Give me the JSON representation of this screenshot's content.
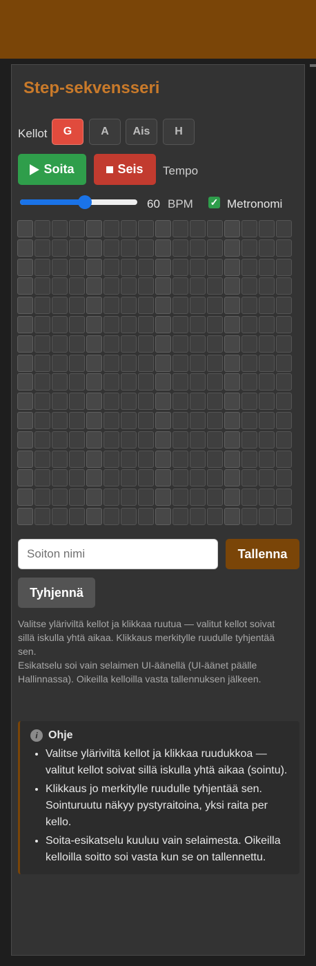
{
  "sequencer": {
    "title": "Step-sekvensseri",
    "bells_label": "Kellot",
    "bells": [
      {
        "label": "G",
        "selected": true
      },
      {
        "label": "A",
        "selected": false
      },
      {
        "label": "Ais",
        "selected": false
      },
      {
        "label": "H",
        "selected": false
      }
    ],
    "play_label": "Soita",
    "stop_label": "Seis",
    "tempo_label": "Tempo",
    "bpm_value": "60",
    "bpm_unit": "BPM",
    "tempo_level": 0.55,
    "metronome_label": "Metronomi",
    "metronome_checked": true,
    "grid": {
      "rows": 16,
      "columns": 16,
      "active_cells": 0
    },
    "name_placeholder": "Soiton nimi",
    "name_value": "",
    "save_label": "Tallenna",
    "clear_label": "Tyhjennä",
    "help_line1": "Valitse yläriviltä kellot ja klikkaa ruutua — valitut kellot soivat sillä iskulla yhtä aikaa. Klikkaus merkitylle ruudulle tyhjentää sen.",
    "help_line2": "Esikatselu soi vain selaimen UI-äänellä (UI-äänet päälle Hallinnassa). Oikeilla kelloilla vasta tallennuksen jälkeen.",
    "info": {
      "title": "Ohje",
      "items": [
        "Valitse yläriviltä kellot ja klikkaa ruudukkoa — valitut kellot soivat sillä iskulla yhtä aikaa (sointu).",
        "Klikkaus jo merkitylle ruudulle tyhjentää sen. Sointuruutu näkyy pystyraitoina, yksi raita per kello.",
        "Soita-esikatselu kuuluu vain selaimesta. Oikeilla kelloilla soitto soi vasta kun se on tallennettu."
      ]
    }
  },
  "colors": {
    "accent": "#7a4508",
    "title": "#c97a2a",
    "play": "#2f9e4b",
    "stop": "#c23b2f",
    "bell_active": "#e14b3d",
    "slider": "#1a73e8"
  },
  "icons": {
    "play": "play-icon",
    "stop": "stop-icon",
    "info": "info-icon",
    "checkbox": "check-icon"
  }
}
